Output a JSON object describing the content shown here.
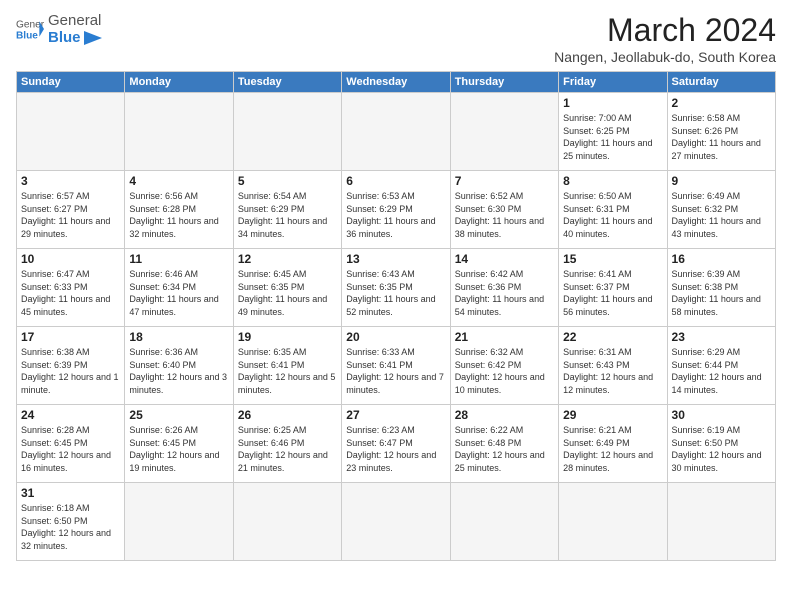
{
  "logo": {
    "general": "General",
    "blue": "Blue"
  },
  "title": "March 2024",
  "subtitle": "Nangen, Jeollabuk-do, South Korea",
  "headers": [
    "Sunday",
    "Monday",
    "Tuesday",
    "Wednesday",
    "Thursday",
    "Friday",
    "Saturday"
  ],
  "weeks": [
    [
      {
        "day": "",
        "info": ""
      },
      {
        "day": "",
        "info": ""
      },
      {
        "day": "",
        "info": ""
      },
      {
        "day": "",
        "info": ""
      },
      {
        "day": "",
        "info": ""
      },
      {
        "day": "1",
        "info": "Sunrise: 7:00 AM\nSunset: 6:25 PM\nDaylight: 11 hours and 25 minutes."
      },
      {
        "day": "2",
        "info": "Sunrise: 6:58 AM\nSunset: 6:26 PM\nDaylight: 11 hours and 27 minutes."
      }
    ],
    [
      {
        "day": "3",
        "info": "Sunrise: 6:57 AM\nSunset: 6:27 PM\nDaylight: 11 hours and 29 minutes."
      },
      {
        "day": "4",
        "info": "Sunrise: 6:56 AM\nSunset: 6:28 PM\nDaylight: 11 hours and 32 minutes."
      },
      {
        "day": "5",
        "info": "Sunrise: 6:54 AM\nSunset: 6:29 PM\nDaylight: 11 hours and 34 minutes."
      },
      {
        "day": "6",
        "info": "Sunrise: 6:53 AM\nSunset: 6:29 PM\nDaylight: 11 hours and 36 minutes."
      },
      {
        "day": "7",
        "info": "Sunrise: 6:52 AM\nSunset: 6:30 PM\nDaylight: 11 hours and 38 minutes."
      },
      {
        "day": "8",
        "info": "Sunrise: 6:50 AM\nSunset: 6:31 PM\nDaylight: 11 hours and 40 minutes."
      },
      {
        "day": "9",
        "info": "Sunrise: 6:49 AM\nSunset: 6:32 PM\nDaylight: 11 hours and 43 minutes."
      }
    ],
    [
      {
        "day": "10",
        "info": "Sunrise: 6:47 AM\nSunset: 6:33 PM\nDaylight: 11 hours and 45 minutes."
      },
      {
        "day": "11",
        "info": "Sunrise: 6:46 AM\nSunset: 6:34 PM\nDaylight: 11 hours and 47 minutes."
      },
      {
        "day": "12",
        "info": "Sunrise: 6:45 AM\nSunset: 6:35 PM\nDaylight: 11 hours and 49 minutes."
      },
      {
        "day": "13",
        "info": "Sunrise: 6:43 AM\nSunset: 6:35 PM\nDaylight: 11 hours and 52 minutes."
      },
      {
        "day": "14",
        "info": "Sunrise: 6:42 AM\nSunset: 6:36 PM\nDaylight: 11 hours and 54 minutes."
      },
      {
        "day": "15",
        "info": "Sunrise: 6:41 AM\nSunset: 6:37 PM\nDaylight: 11 hours and 56 minutes."
      },
      {
        "day": "16",
        "info": "Sunrise: 6:39 AM\nSunset: 6:38 PM\nDaylight: 11 hours and 58 minutes."
      }
    ],
    [
      {
        "day": "17",
        "info": "Sunrise: 6:38 AM\nSunset: 6:39 PM\nDaylight: 12 hours and 1 minute."
      },
      {
        "day": "18",
        "info": "Sunrise: 6:36 AM\nSunset: 6:40 PM\nDaylight: 12 hours and 3 minutes."
      },
      {
        "day": "19",
        "info": "Sunrise: 6:35 AM\nSunset: 6:41 PM\nDaylight: 12 hours and 5 minutes."
      },
      {
        "day": "20",
        "info": "Sunrise: 6:33 AM\nSunset: 6:41 PM\nDaylight: 12 hours and 7 minutes."
      },
      {
        "day": "21",
        "info": "Sunrise: 6:32 AM\nSunset: 6:42 PM\nDaylight: 12 hours and 10 minutes."
      },
      {
        "day": "22",
        "info": "Sunrise: 6:31 AM\nSunset: 6:43 PM\nDaylight: 12 hours and 12 minutes."
      },
      {
        "day": "23",
        "info": "Sunrise: 6:29 AM\nSunset: 6:44 PM\nDaylight: 12 hours and 14 minutes."
      }
    ],
    [
      {
        "day": "24",
        "info": "Sunrise: 6:28 AM\nSunset: 6:45 PM\nDaylight: 12 hours and 16 minutes."
      },
      {
        "day": "25",
        "info": "Sunrise: 6:26 AM\nSunset: 6:45 PM\nDaylight: 12 hours and 19 minutes."
      },
      {
        "day": "26",
        "info": "Sunrise: 6:25 AM\nSunset: 6:46 PM\nDaylight: 12 hours and 21 minutes."
      },
      {
        "day": "27",
        "info": "Sunrise: 6:23 AM\nSunset: 6:47 PM\nDaylight: 12 hours and 23 minutes."
      },
      {
        "day": "28",
        "info": "Sunrise: 6:22 AM\nSunset: 6:48 PM\nDaylight: 12 hours and 25 minutes."
      },
      {
        "day": "29",
        "info": "Sunrise: 6:21 AM\nSunset: 6:49 PM\nDaylight: 12 hours and 28 minutes."
      },
      {
        "day": "30",
        "info": "Sunrise: 6:19 AM\nSunset: 6:50 PM\nDaylight: 12 hours and 30 minutes."
      }
    ],
    [
      {
        "day": "31",
        "info": "Sunrise: 6:18 AM\nSunset: 6:50 PM\nDaylight: 12 hours and 32 minutes."
      },
      {
        "day": "",
        "info": ""
      },
      {
        "day": "",
        "info": ""
      },
      {
        "day": "",
        "info": ""
      },
      {
        "day": "",
        "info": ""
      },
      {
        "day": "",
        "info": ""
      },
      {
        "day": "",
        "info": ""
      }
    ]
  ]
}
